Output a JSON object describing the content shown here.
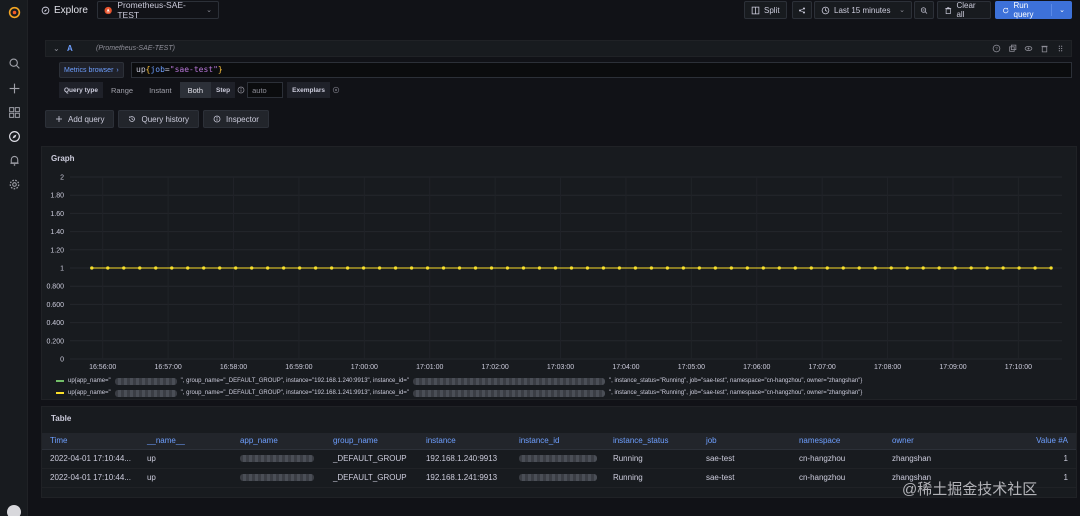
{
  "topbar": {
    "title": "Explore",
    "datasource": "Prometheus-SAE-TEST",
    "split": "Split",
    "time_range": "Last 15 minutes",
    "clear_all": "Clear all",
    "run_query": "Run query"
  },
  "query": {
    "ref_id": "A",
    "ds_name": "(Prometheus-SAE-TEST)",
    "metrics_browser": "Metrics browser",
    "expr_fn": "up",
    "expr_label": "job",
    "expr_op": "=",
    "expr_value": "\"sae-test\"",
    "query_type_label": "Query type",
    "query_types": [
      "Range",
      "Instant",
      "Both"
    ],
    "active_query_type": "Both",
    "step_label": "Step",
    "step_placeholder": "auto",
    "exemplars_label": "Exemplars"
  },
  "actions": {
    "add_query": "Add query",
    "query_history": "Query history",
    "inspector": "Inspector"
  },
  "graph": {
    "panel_title": "Graph"
  },
  "chart_data": {
    "type": "line",
    "title": "Graph",
    "xlabel": "",
    "ylabel": "",
    "ylim": [
      0,
      2
    ],
    "y_ticks": [
      "0",
      "0.200",
      "0.400",
      "0.600",
      "0.800",
      "1",
      "1.20",
      "1.40",
      "1.60",
      "1.80",
      "2"
    ],
    "x_ticks": [
      "16:56:00",
      "16:57:00",
      "16:58:00",
      "16:59:00",
      "17:00:00",
      "17:01:00",
      "17:02:00",
      "17:03:00",
      "17:04:00",
      "17:05:00",
      "17:06:00",
      "17:07:00",
      "17:08:00",
      "17:09:00",
      "17:10:00"
    ],
    "x_range": [
      "16:55:30",
      "17:10:40"
    ],
    "point_count": 61,
    "series": [
      {
        "name_prefix": "up{app_name=\"",
        "name_mid": "\", group_name=\"_DEFAULT_GROUP\", instance=\"192.168.1.240:9913\", instance_id=\"",
        "name_suffix": "\", instance_status=\"Running\", job=\"sae-test\", namespace=\"cn-hangzhou\", owner=\"zhangshan\"}",
        "color": "#73bf69",
        "value": 1
      },
      {
        "name_prefix": "up{app_name=\"",
        "name_mid": "\", group_name=\"_DEFAULT_GROUP\", instance=\"192.168.1.241:9913\", instance_id=\"",
        "name_suffix": "\", instance_status=\"Running\", job=\"sae-test\", namespace=\"cn-hangzhou\", owner=\"zhangshan\"}",
        "color": "#fade2a",
        "value": 1
      }
    ],
    "grid": true,
    "legend": "bottom"
  },
  "table": {
    "panel_title": "Table",
    "columns": [
      "Time",
      "__name__",
      "app_name",
      "group_name",
      "instance",
      "instance_id",
      "instance_status",
      "job",
      "namespace",
      "owner",
      "Value #A"
    ],
    "rows": [
      [
        "2022-04-01 17:10:44...",
        "up",
        "",
        "_DEFAULT_GROUP",
        "192.168.1.240:9913",
        "",
        "Running",
        "sae-test",
        "cn-hangzhou",
        "zhangshan",
        "1"
      ],
      [
        "2022-04-01 17:10:44...",
        "up",
        "",
        "_DEFAULT_GROUP",
        "192.168.1.241:9913",
        "",
        "Running",
        "sae-test",
        "cn-hangzhou",
        "zhangshan",
        "1"
      ]
    ]
  },
  "watermark": "@稀土掘金技术社区",
  "colors": {
    "accent": "#3d71d9",
    "link": "#6e9fff",
    "series_green": "#73bf69",
    "series_yellow": "#fade2a"
  },
  "icons": {
    "sidebar": [
      "grafana-logo-icon",
      "search-icon",
      "plus-icon",
      "dashboards-icon",
      "explore-compass-icon",
      "alert-bell-icon",
      "gear-icon"
    ]
  }
}
